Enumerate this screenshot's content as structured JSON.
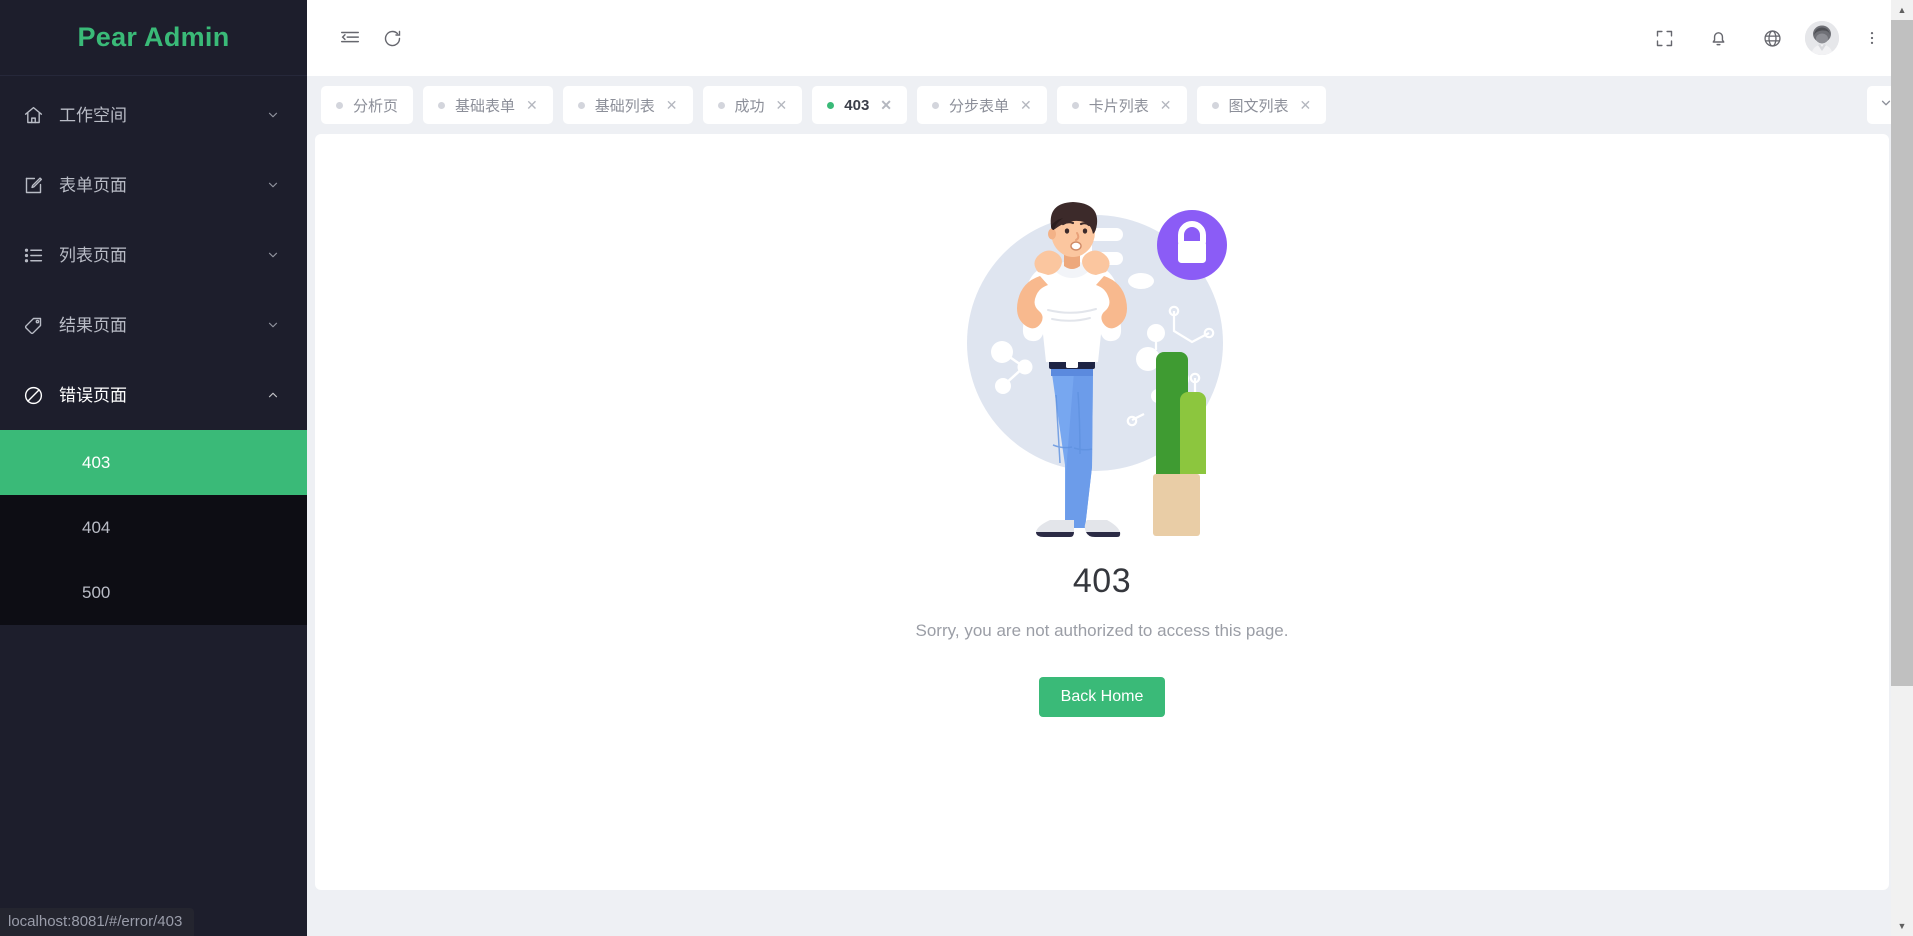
{
  "brand": {
    "title": "Pear Admin"
  },
  "sidebar": {
    "items": [
      {
        "label": "工作空间",
        "icon": "home-icon",
        "expanded": false
      },
      {
        "label": "表单页面",
        "icon": "edit-square-icon",
        "expanded": false
      },
      {
        "label": "列表页面",
        "icon": "list-icon",
        "expanded": false
      },
      {
        "label": "结果页面",
        "icon": "tag-icon",
        "expanded": false
      },
      {
        "label": "错误页面",
        "icon": "ban-circle-icon",
        "expanded": true
      }
    ],
    "submenu": [
      {
        "label": "403",
        "active": true
      },
      {
        "label": "404",
        "active": false
      },
      {
        "label": "500",
        "active": false
      }
    ]
  },
  "statusbar": {
    "url": "localhost:8081/#/error/403"
  },
  "header": {
    "collapse_icon": "menu-fold-icon",
    "refresh_icon": "refresh-icon",
    "fullscreen_icon": "fullscreen-icon",
    "bell_icon": "bell-icon",
    "globe_icon": "globe-icon",
    "avatar_icon": "user-avatar",
    "more_icon": "more-vertical-icon"
  },
  "tabs": {
    "items": [
      {
        "label": "分析页",
        "active": false,
        "closable": false
      },
      {
        "label": "基础表单",
        "active": false,
        "closable": true
      },
      {
        "label": "基础列表",
        "active": false,
        "closable": true
      },
      {
        "label": "成功",
        "active": false,
        "closable": true
      },
      {
        "label": "403",
        "active": true,
        "closable": true
      },
      {
        "label": "分步表单",
        "active": false,
        "closable": true
      },
      {
        "label": "卡片列表",
        "active": false,
        "closable": true
      },
      {
        "label": "图文列表",
        "active": false,
        "closable": true
      }
    ],
    "close_glyph": "✕",
    "more_label": "tab-dropdown"
  },
  "error_page": {
    "code": "403",
    "message": "Sorry, you are not authorized to access this page.",
    "button_label": "Back Home",
    "illustration": "forbidden-access-illustration"
  },
  "colors": {
    "brand_green": "#3aba78",
    "sidebar_bg": "#1d1e2c",
    "submenu_bg": "#0d0d14",
    "page_bg": "#eef0f4",
    "lock_purple": "#8b5cf6",
    "circle_blue": "#dde3ef"
  }
}
